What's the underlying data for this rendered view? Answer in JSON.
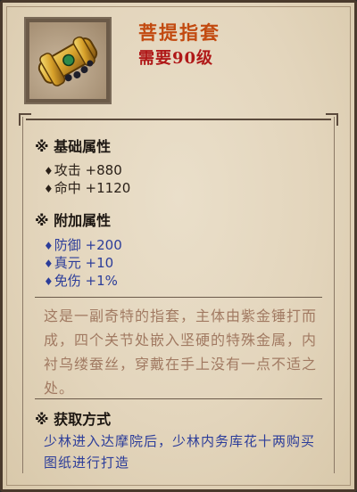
{
  "item": {
    "name": "菩提指套",
    "requirement": "需要90级",
    "icon": "golden-finger-guard-icon"
  },
  "basic_section": {
    "title": "※ 基础属性",
    "stats": [
      {
        "bullet": "♦",
        "label": "攻击 +880"
      },
      {
        "bullet": "♦",
        "label": "命中 +1120"
      }
    ]
  },
  "extra_section": {
    "title": "※ 附加属性",
    "stats": [
      {
        "bullet": "♦",
        "label": "防御 +200"
      },
      {
        "bullet": "♦",
        "label": "真元 +10"
      },
      {
        "bullet": "♦",
        "label": "免伤 +1%"
      }
    ]
  },
  "description": "这是一副奇特的指套，主体由紫金锤打而成，四个关节处嵌入坚硬的特殊金属，内衬乌缕蚕丝，穿戴在手上没有一点不适之处。",
  "obtain_section": {
    "title": "※ 获取方式",
    "text": "少林进入达摩院后，少林内务库花十两购买图纸进行打造"
  },
  "colors": {
    "name": "#c24a10",
    "requirement": "#b01818",
    "extra_stats": "#2c3d9a",
    "description": "#a17a62",
    "parchment": "#e3d5bc"
  }
}
